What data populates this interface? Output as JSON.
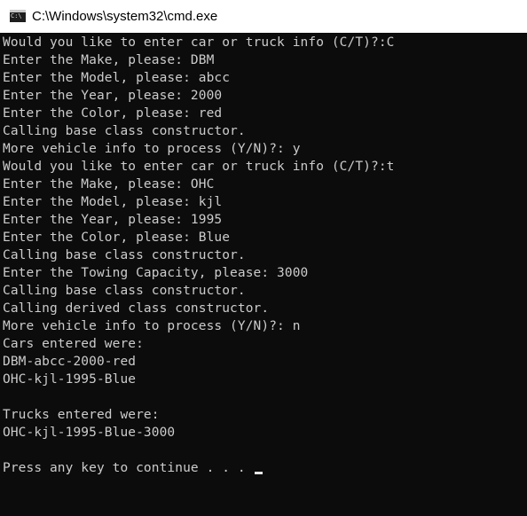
{
  "window": {
    "title": "C:\\Windows\\system32\\cmd.exe",
    "icon": "console-icon",
    "icon_glyph": "C:\\"
  },
  "console": {
    "background": "#0c0c0c",
    "foreground": "#cccccc",
    "lines": [
      "Would you like to enter car or truck info (C/T)?:C",
      "Enter the Make, please: DBM",
      "Enter the Model, please: abcc",
      "Enter the Year, please: 2000",
      "Enter the Color, please: red",
      "Calling base class constructor.",
      "More vehicle info to process (Y/N)?: y",
      "Would you like to enter car or truck info (C/T)?:t",
      "Enter the Make, please: OHC",
      "Enter the Model, please: kjl",
      "Enter the Year, please: 1995",
      "Enter the Color, please: Blue",
      "Calling base class constructor.",
      "Enter the Towing Capacity, please: 3000",
      "Calling base class constructor.",
      "Calling derived class constructor.",
      "More vehicle info to process (Y/N)?: n",
      "Cars entered were:",
      "DBM-abcc-2000-red",
      "OHC-kjl-1995-Blue",
      "",
      "Trucks entered were:",
      "OHC-kjl-1995-Blue-3000",
      "",
      "Press any key to continue . . . "
    ]
  }
}
